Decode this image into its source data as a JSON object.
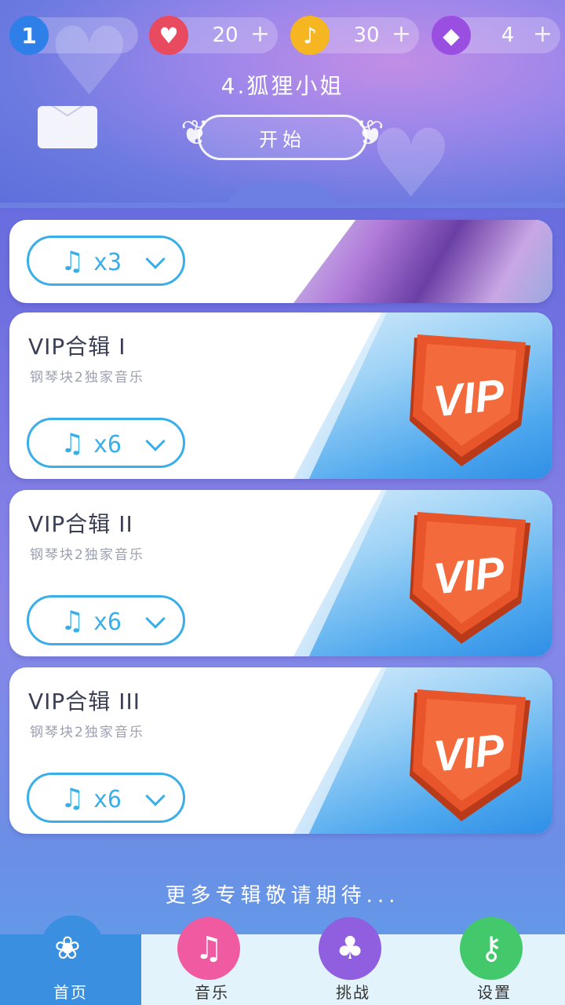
{
  "header": {
    "level": "1",
    "hearts": {
      "value": "20",
      "plus": "+"
    },
    "notes": {
      "value": "30",
      "plus": "+"
    },
    "gems": {
      "value": "4",
      "plus": "+"
    },
    "song_title": "4.狐狸小姐",
    "start_label": "开始"
  },
  "albums": [
    {
      "title": "",
      "subtitle": "",
      "count": "x3"
    },
    {
      "title": "VIP合辑 I",
      "subtitle": "钢琴块2独家音乐",
      "count": "x6",
      "badge": "VIP"
    },
    {
      "title": "VIP合辑 II",
      "subtitle": "钢琴块2独家音乐",
      "count": "x6",
      "badge": "VIP"
    },
    {
      "title": "VIP合辑 III",
      "subtitle": "钢琴块2独家音乐",
      "count": "x6",
      "badge": "VIP"
    }
  ],
  "more_text": "更多专辑敬请期待...",
  "nav": [
    {
      "label": "首页",
      "icon": "rose-icon",
      "color": "#3a8fe0"
    },
    {
      "label": "音乐",
      "icon": "music-note-icon",
      "color": "#ef5aa0"
    },
    {
      "label": "挑战",
      "icon": "tree-icon",
      "color": "#8f5fe0"
    },
    {
      "label": "设置",
      "icon": "lock-icon",
      "color": "#43c96b"
    }
  ],
  "colors": {
    "accent": "#3aaee8",
    "vip_orange": "#e8552a",
    "heart": "#e84a5f",
    "note": "#f5b621",
    "gem": "#9b4fe0"
  }
}
